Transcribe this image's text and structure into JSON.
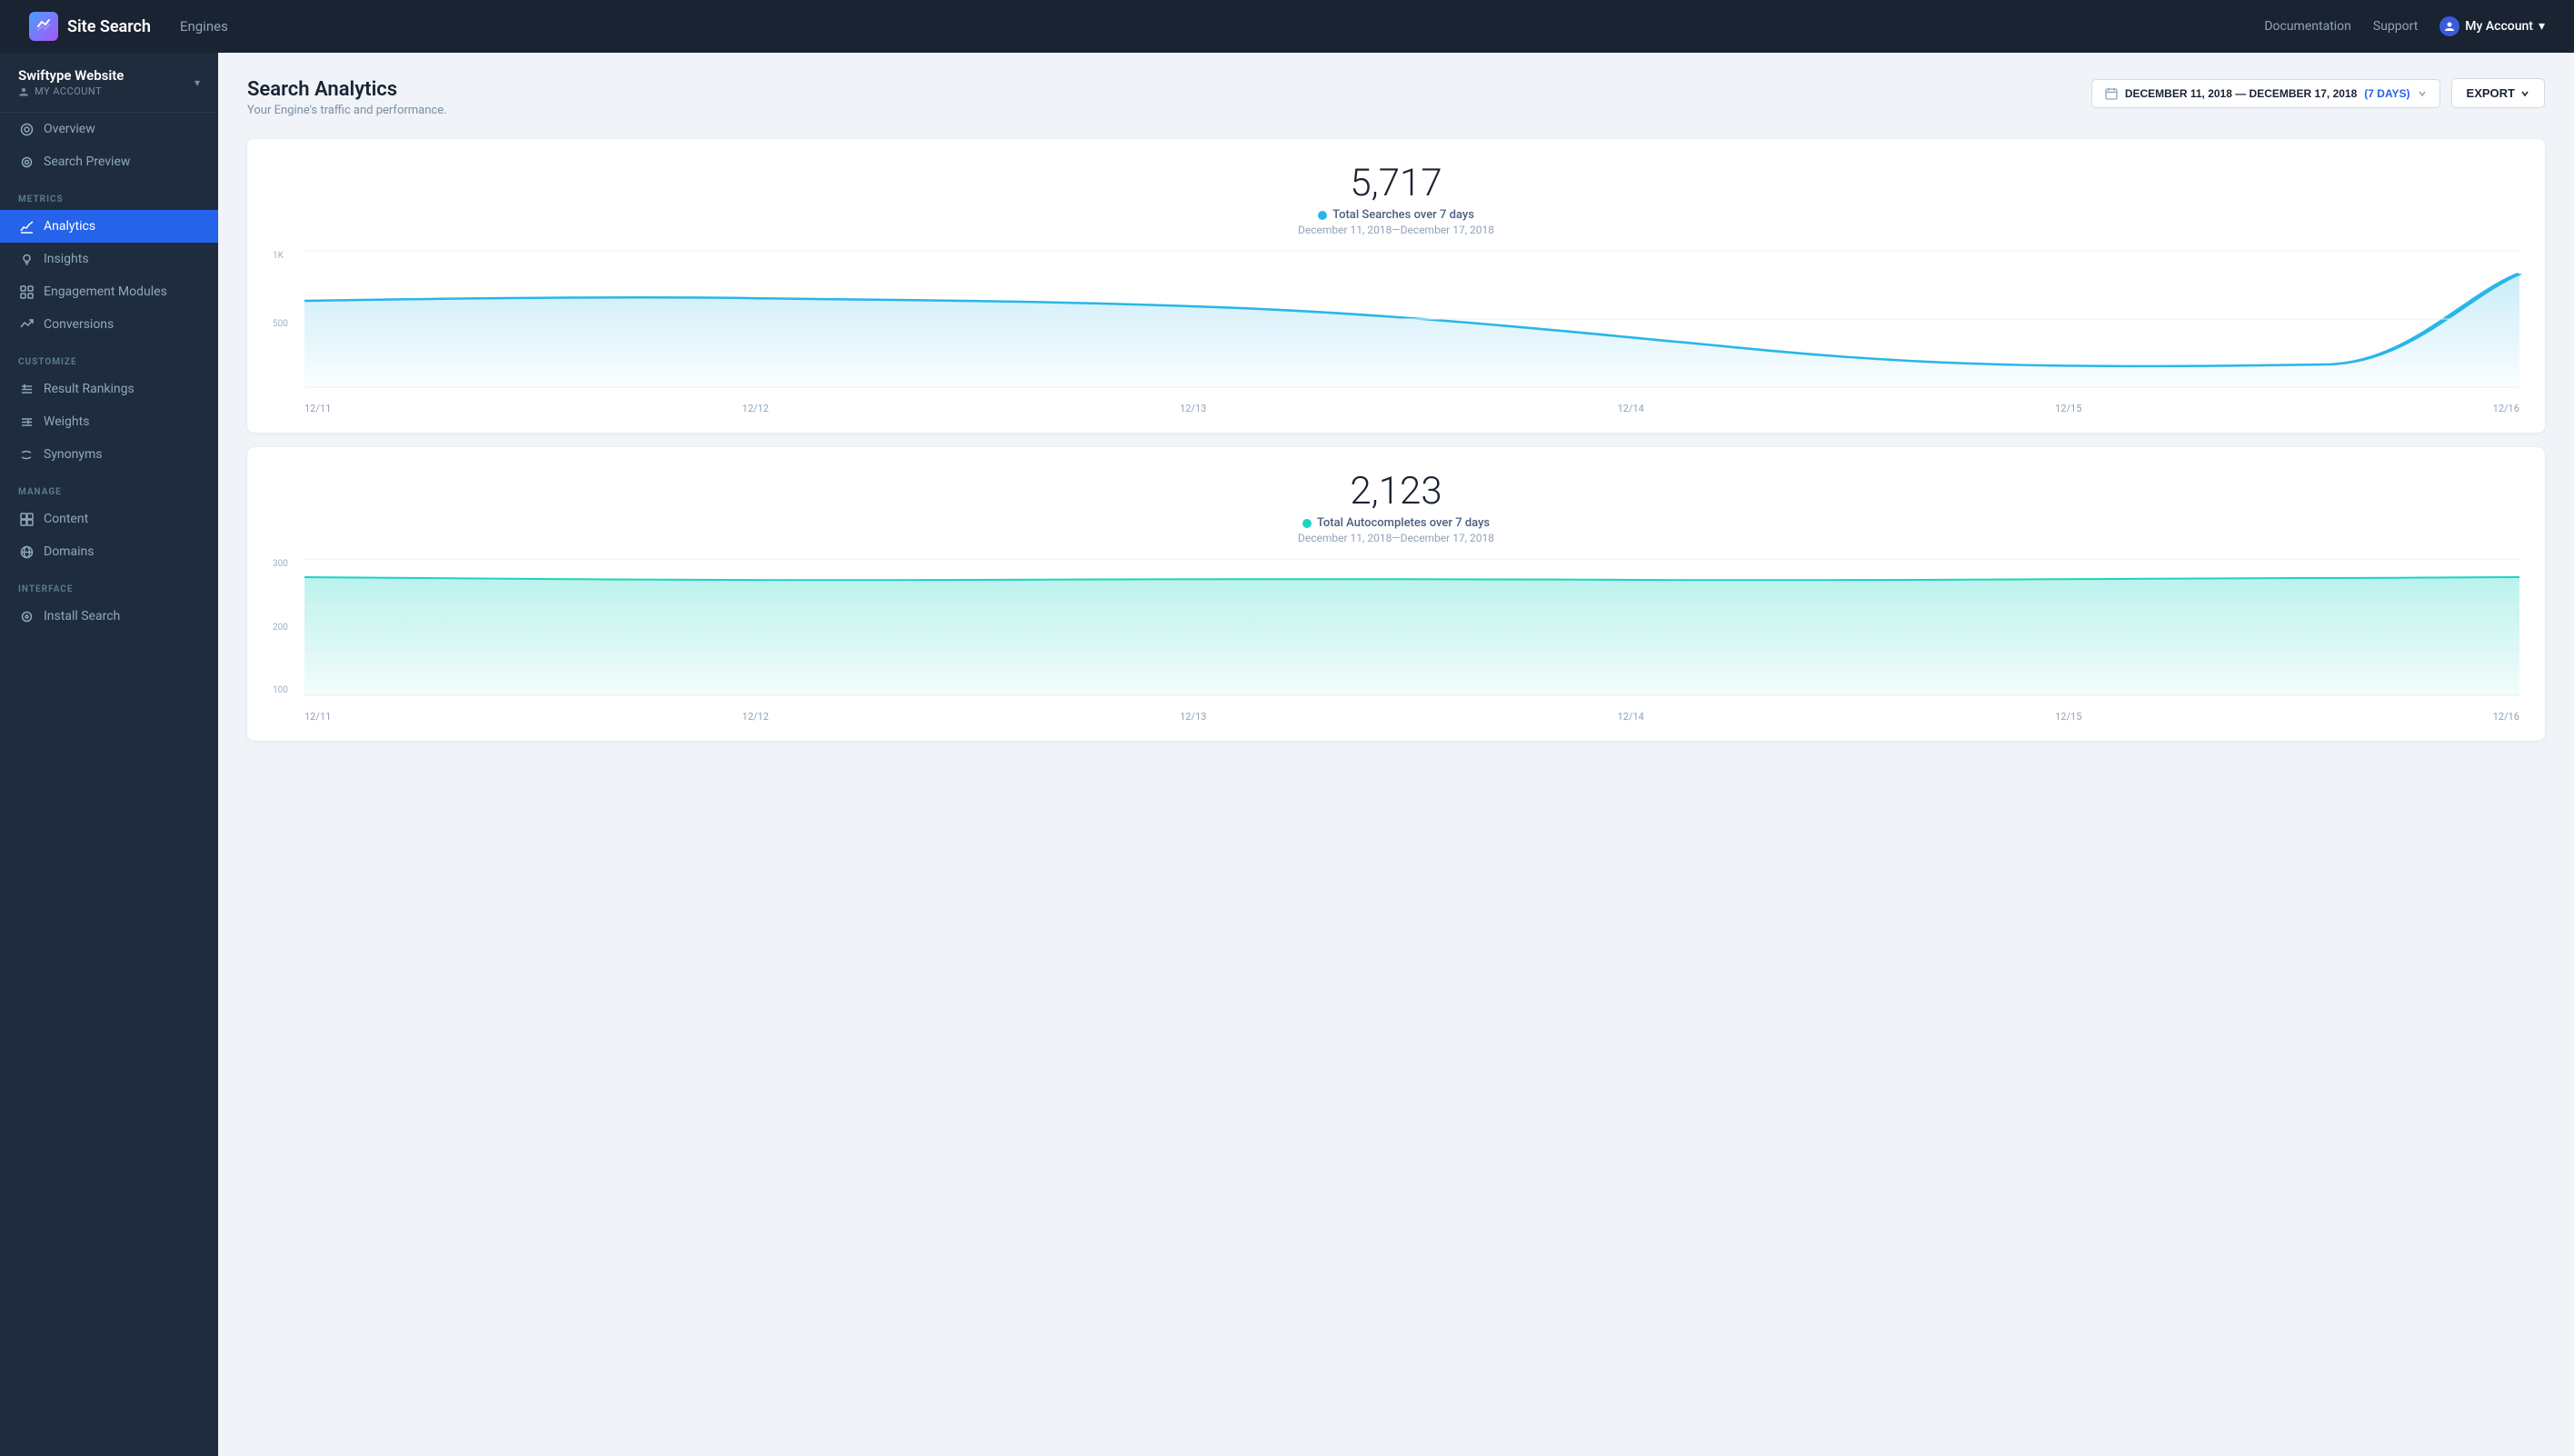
{
  "app": {
    "logo_text": "⚡",
    "name": "Site Search",
    "nav_item": "Engines"
  },
  "topnav": {
    "documentation": "Documentation",
    "support": "Support",
    "my_account": "My Account",
    "chevron": "▾"
  },
  "sidebar": {
    "engine_name": "Swiftype Website",
    "account_label": "MY ACCOUNT",
    "chevron": "▾",
    "items_top": [
      {
        "id": "overview",
        "label": "Overview",
        "icon": "◎"
      },
      {
        "id": "search-preview",
        "label": "Search Preview",
        "icon": "👁"
      }
    ],
    "section_metrics": "METRICS",
    "items_metrics": [
      {
        "id": "analytics",
        "label": "Analytics",
        "icon": "📈",
        "active": true
      },
      {
        "id": "insights",
        "label": "Insights",
        "icon": "💡"
      },
      {
        "id": "engagement",
        "label": "Engagement Modules",
        "icon": "🔲"
      },
      {
        "id": "conversions",
        "label": "Conversions",
        "icon": "⊿"
      }
    ],
    "section_customize": "CUSTOMIZE",
    "items_customize": [
      {
        "id": "result-rankings",
        "label": "Result Rankings",
        "icon": "≡"
      },
      {
        "id": "weights",
        "label": "Weights",
        "icon": "≡"
      },
      {
        "id": "synonyms",
        "label": "Synonyms",
        "icon": "〜"
      }
    ],
    "section_manage": "MANAGE",
    "items_manage": [
      {
        "id": "content",
        "label": "Content",
        "icon": "▦"
      },
      {
        "id": "domains",
        "label": "Domains",
        "icon": "🌐"
      }
    ],
    "section_interface": "INTERFACE",
    "items_interface": [
      {
        "id": "install-search",
        "label": "Install Search",
        "icon": "⚙"
      }
    ]
  },
  "page": {
    "title": "Search Analytics",
    "subtitle": "Your Engine's traffic and performance.",
    "date_range": "DECEMBER 11, 2018 — DECEMBER 17, 2018",
    "days_badge": "(7 DAYS)",
    "export_label": "EXPORT",
    "cal_icon": "📅"
  },
  "chart1": {
    "number": "5,717",
    "label": "Total Searches over 7 days",
    "date_range": "December 11, 2018—December 17, 2018",
    "dot_color": "#29b6e8",
    "y_labels": [
      "1K",
      "500",
      ""
    ],
    "x_labels": [
      "12/11",
      "12/12",
      "12/13",
      "12/14",
      "12/15",
      "12/16"
    ],
    "line_color": "#29b6e8",
    "fill_color": "rgba(41,182,232,0.12)"
  },
  "chart2": {
    "number": "2,123",
    "label": "Total Autocompletes over 7 days",
    "date_range": "December 11, 2018—December 17, 2018",
    "dot_color": "#29e8cc",
    "y_labels": [
      "300",
      "200",
      "100"
    ],
    "x_labels": [
      "12/11",
      "12/12",
      "12/13",
      "12/14",
      "12/15",
      "12/16"
    ],
    "line_color": "#1bd4c0",
    "fill_color": "rgba(27,212,192,0.15)"
  }
}
